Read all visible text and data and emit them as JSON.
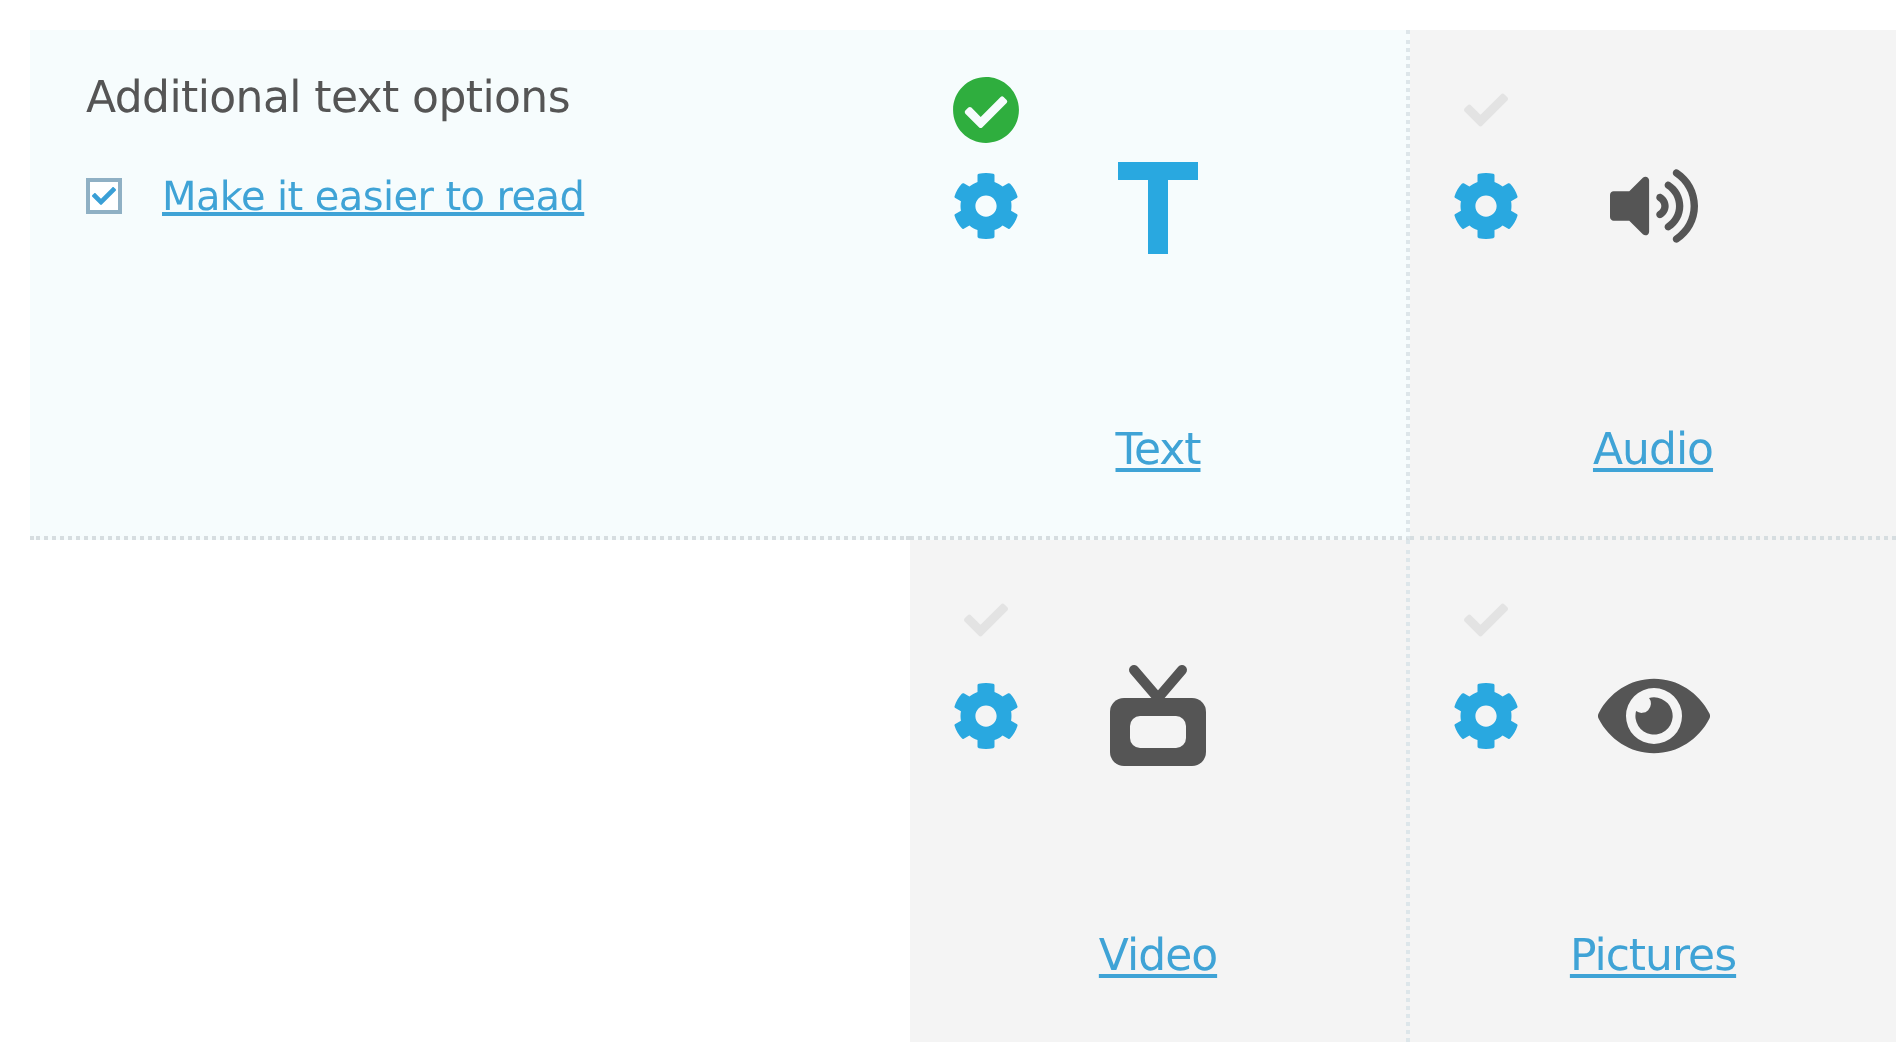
{
  "options": {
    "title": "Additional text options",
    "checkbox": {
      "label": "Make it easier to read",
      "checked": true
    }
  },
  "tiles": [
    {
      "kind": "text",
      "label": "Text",
      "selected": true
    },
    {
      "kind": "audio",
      "label": "Audio",
      "selected": false
    },
    {
      "kind": "video",
      "label": "Video",
      "selected": false
    },
    {
      "kind": "pictures",
      "label": "Pictures",
      "selected": false
    }
  ]
}
